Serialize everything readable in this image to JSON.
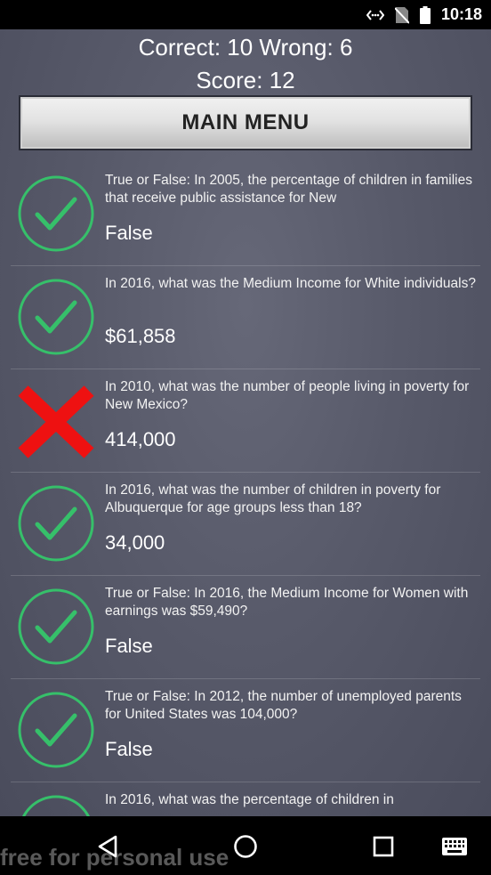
{
  "status_bar": {
    "time": "10:18"
  },
  "header": {
    "correct_wrong": "Correct: 10 Wrong: 6",
    "score": "Score: 12"
  },
  "main_menu_label": "MAIN MENU",
  "results": [
    {
      "status": "correct",
      "question": "True or False: In 2005, the percentage of children in families that receive public assistance for New",
      "answer": "False"
    },
    {
      "status": "correct",
      "question": "In 2016, what was the Medium Income for White individuals?",
      "answer": "$61,858"
    },
    {
      "status": "wrong",
      "question": "In 2010, what was the number of people living in poverty for New Mexico?",
      "answer": "414,000"
    },
    {
      "status": "correct",
      "question": "In 2016, what was the number of children in poverty for Albuquerque for age groups less than 18?",
      "answer": "34,000"
    },
    {
      "status": "correct",
      "question": "True or False: In 2016, the Medium Income for Women with earnings was $59,490?",
      "answer": "False"
    },
    {
      "status": "correct",
      "question": "True or False: In 2012, the number of unemployed parents for United States was 104,000?",
      "answer": "False"
    },
    {
      "status": "correct",
      "question": "In 2016, what was the percentage of children in",
      "answer": ""
    }
  ],
  "colors": {
    "correct": "#36c06a",
    "wrong": "#ee1111"
  },
  "icons": {
    "correct": "check-circle-icon",
    "wrong": "x-mark-icon",
    "back": "back-triangle-icon",
    "home": "home-circle-icon",
    "recents": "recents-square-icon",
    "keyboard": "keyboard-icon"
  },
  "watermark": "free for personal use"
}
